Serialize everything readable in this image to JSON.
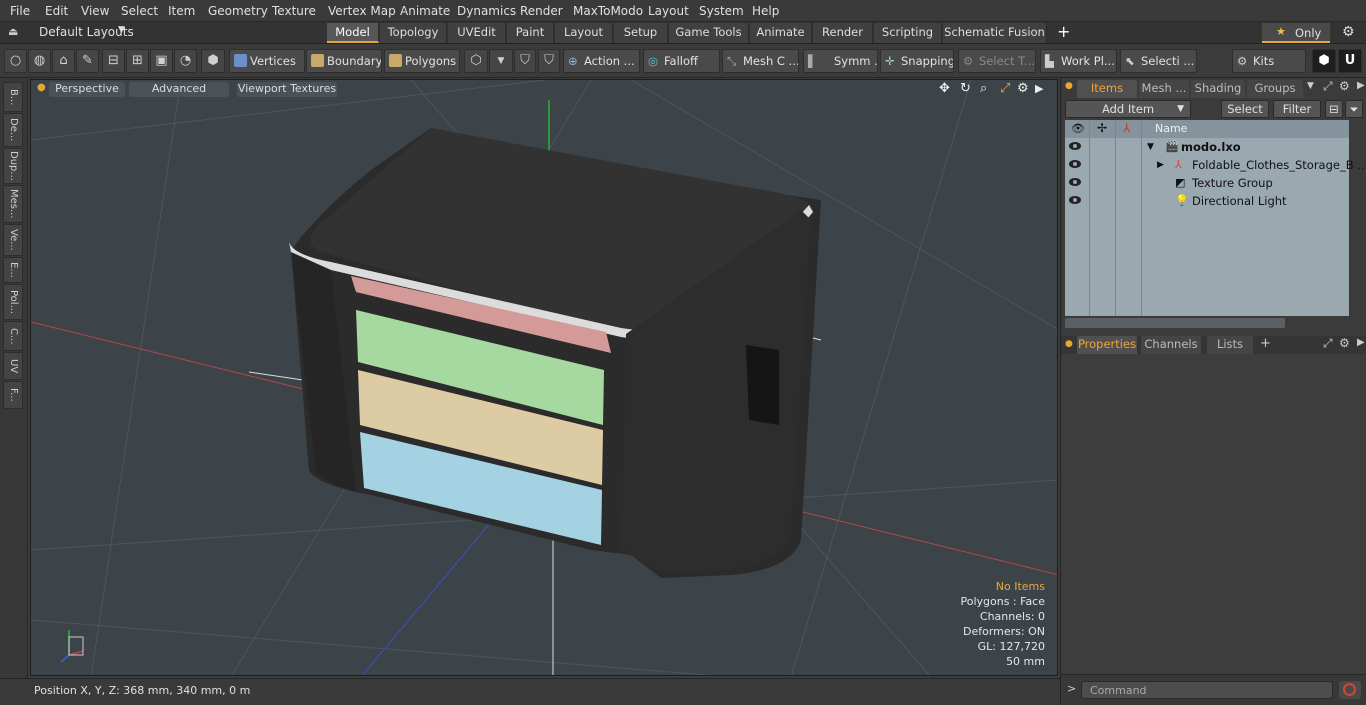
{
  "menu": [
    "File",
    "Edit",
    "View",
    "Select",
    "Item",
    "Geometry",
    "Texture",
    "Vertex Map",
    "Animate",
    "Dynamics",
    "Render",
    "MaxToModo",
    "Layout",
    "System",
    "Help"
  ],
  "layouts": {
    "label": "Default Layouts"
  },
  "mode_tabs": [
    "Model",
    "Topology",
    "UVEdit",
    "Paint",
    "Layout",
    "Setup",
    "Game Tools",
    "Animate",
    "Render",
    "Scripting",
    "Schematic Fusion"
  ],
  "only_label": "Only",
  "toolbar": {
    "vertices": "Vertices",
    "boundary": "Boundary",
    "polygons": "Polygons",
    "action": "Action ...",
    "falloff": "Falloff",
    "mesh": "Mesh C ...",
    "symm": "Symm ...",
    "snapping": "Snapping",
    "select_t": "Select T...",
    "workpl": "Work Pl...",
    "selecti": "Selecti ...",
    "kits": "Kits"
  },
  "left_tabs": [
    "B...",
    "De...",
    "Dup...",
    "Mes...",
    "Ve...",
    "E...",
    "Pol...",
    "C...",
    "UV",
    "F..."
  ],
  "viewport": {
    "perspective": "Perspective",
    "advanced": "Advanced",
    "textures": "Viewport Textures",
    "stats": {
      "no_items": "No Items",
      "polygons": "Polygons : Face",
      "channels": "Channels: 0",
      "deformers": "Deformers: ON",
      "gl": "GL: 127,720",
      "scale": "50 mm"
    }
  },
  "status": {
    "position": "Position X, Y, Z:  368 mm, 340 mm, 0 m"
  },
  "items_panel": {
    "tabs": [
      "Items",
      "Mesh ...",
      "Shading",
      "Groups"
    ],
    "add_item": "Add Item",
    "select": "Select",
    "filter": "Filter",
    "col_name": "Name",
    "tree": [
      "modo.lxo",
      "Foldable_Clothes_Storage_B ...",
      "Texture Group",
      "Directional Light"
    ]
  },
  "props_panel": {
    "tabs": [
      "Properties",
      "Channels",
      "Lists"
    ]
  },
  "command": {
    "placeholder": "Command"
  },
  "colors": {
    "accent": "#e7a63c",
    "viewport_bg": "#3c4449",
    "list_bg": "#9aa8b0"
  }
}
